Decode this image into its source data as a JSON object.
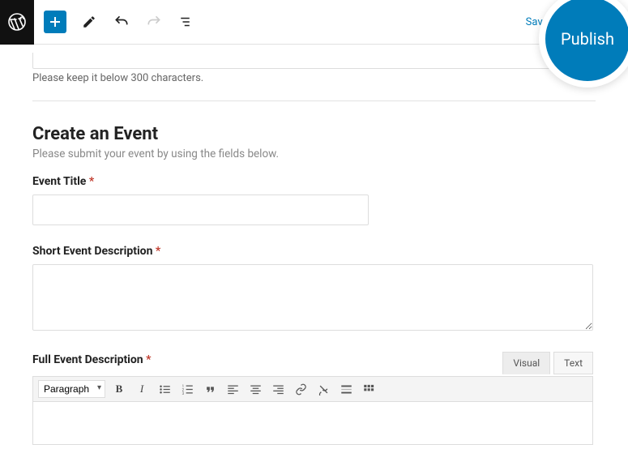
{
  "topbar": {
    "save_draft": "Save draft",
    "publish": "Publish"
  },
  "prev_help": "Please keep it below 300 characters.",
  "section": {
    "title": "Create an Event",
    "subtitle": "Please submit your event by using the fields below."
  },
  "fields": {
    "title_label": "Event Title",
    "short_label": "Short Event Description",
    "full_label": "Full Event Description",
    "required": "*"
  },
  "editor": {
    "tab_visual": "Visual",
    "tab_text": "Text",
    "format": "Paragraph"
  }
}
